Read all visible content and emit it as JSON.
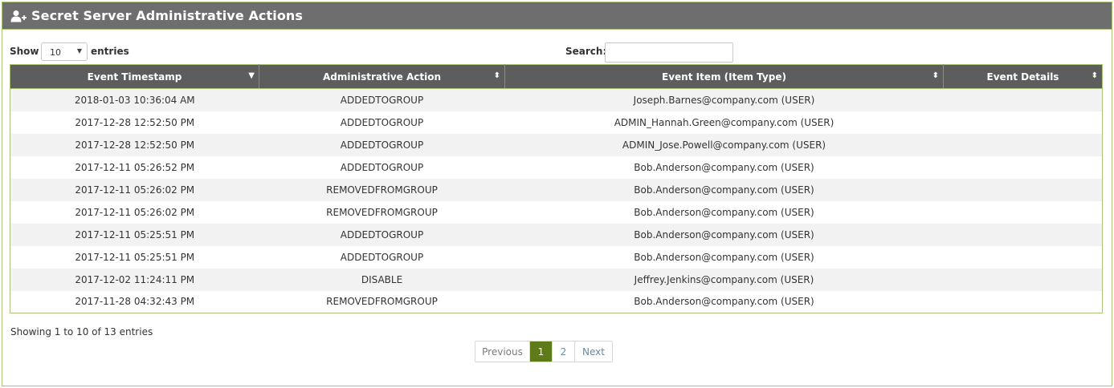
{
  "header": {
    "title": "Secret Server Administrative Actions",
    "icon": "user-add-icon"
  },
  "controls": {
    "show_label": "Show",
    "page_size": "10",
    "entries_label": "entries",
    "search_label": "Search:",
    "search_value": ""
  },
  "table": {
    "columns": [
      {
        "label": "Event Timestamp",
        "sort": "sorted-desc"
      },
      {
        "label": "Administrative Action",
        "sort": "sortable"
      },
      {
        "label": "Event Item (Item Type)",
        "sort": "sortable"
      },
      {
        "label": "Event Details",
        "sort": "sortable"
      }
    ],
    "rows": [
      [
        "2018-01-03 10:36:04 AM",
        "ADDEDTOGROUP",
        "Joseph.Barnes@company.com (USER)",
        ""
      ],
      [
        "2017-12-28 12:52:50 PM",
        "ADDEDTOGROUP",
        "ADMIN_Hannah.Green@company.com (USER)",
        ""
      ],
      [
        "2017-12-28 12:52:50 PM",
        "ADDEDTOGROUP",
        "ADMIN_Jose.Powell@company.com (USER)",
        ""
      ],
      [
        "2017-12-11 05:26:52 PM",
        "ADDEDTOGROUP",
        "Bob.Anderson@company.com (USER)",
        ""
      ],
      [
        "2017-12-11 05:26:02 PM",
        "REMOVEDFROMGROUP",
        "Bob.Anderson@company.com (USER)",
        ""
      ],
      [
        "2017-12-11 05:26:02 PM",
        "REMOVEDFROMGROUP",
        "Bob.Anderson@company.com (USER)",
        ""
      ],
      [
        "2017-12-11 05:25:51 PM",
        "ADDEDTOGROUP",
        "Bob.Anderson@company.com (USER)",
        ""
      ],
      [
        "2017-12-11 05:25:51 PM",
        "ADDEDTOGROUP",
        "Bob.Anderson@company.com (USER)",
        ""
      ],
      [
        "2017-12-02 11:24:11 PM",
        "DISABLE",
        "Jeffrey.Jenkins@company.com (USER)",
        ""
      ],
      [
        "2017-11-28 04:32:43 PM",
        "REMOVEDFROMGROUP",
        "Bob.Anderson@company.com (USER)",
        ""
      ]
    ]
  },
  "footer": {
    "info": "Showing 1 to 10 of 13 entries",
    "pager": {
      "previous": "Previous",
      "pages": [
        "1",
        "2"
      ],
      "active_page": "1",
      "next": "Next"
    }
  },
  "colors": {
    "header_bg": "#6e6e6e",
    "table_header_bg": "#5d5d5d",
    "accent_border": "#a9c27a",
    "active_page_bg": "#5f7a18"
  }
}
